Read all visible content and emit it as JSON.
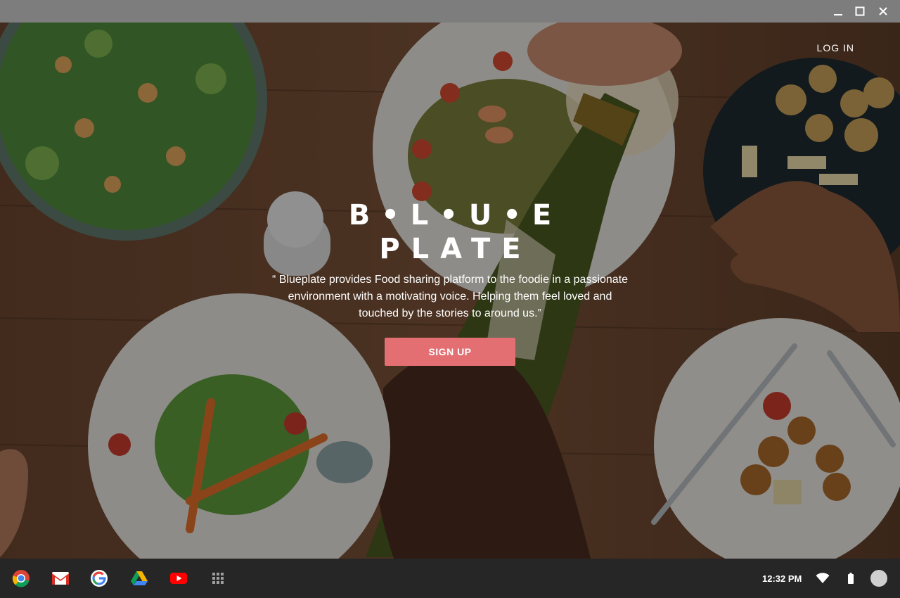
{
  "window": {
    "controls": [
      "minimize-icon",
      "maximize-icon",
      "close-icon"
    ]
  },
  "app": {
    "login_label": "LOG IN",
    "brand_line1": "B•L•U•E",
    "brand_line2": "PLATE",
    "tagline": "“ Blueplate provides Food sharing platform to the foodie in a passionate environment with a motivating voice. Helping them feel loved and touched by the stories to around us.”",
    "signup_label": "SIGN UP",
    "accent_color": "#e36f73"
  },
  "shelf": {
    "apps": [
      "chrome-icon",
      "gmail-icon",
      "google-icon",
      "drive-icon",
      "youtube-icon",
      "launcher-icon"
    ],
    "time": "12:32 PM",
    "tray": [
      "wifi-icon",
      "battery-icon",
      "avatar"
    ]
  }
}
